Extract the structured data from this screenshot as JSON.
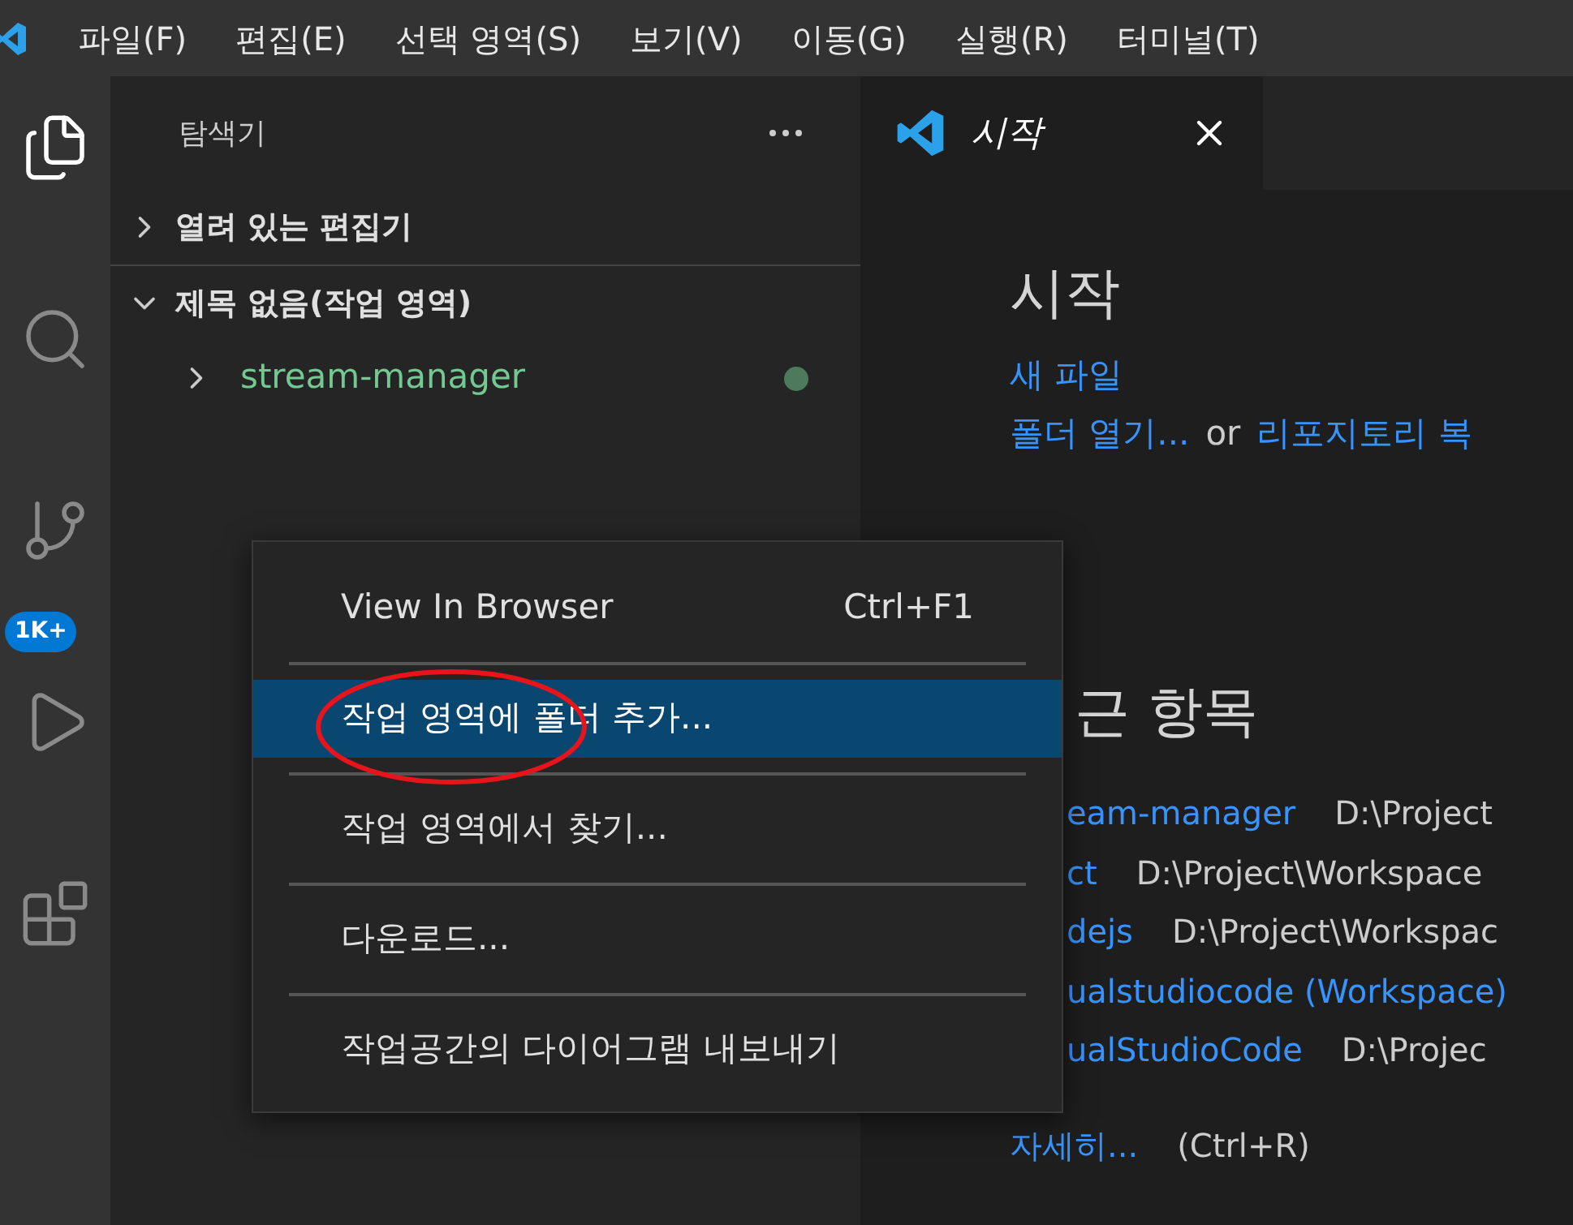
{
  "menu_bar": {
    "items": [
      "파일(F)",
      "편집(E)",
      "선택 영역(S)",
      "보기(V)",
      "이동(G)",
      "실행(R)",
      "터미널(T)"
    ]
  },
  "activity_bar": {
    "items": [
      {
        "kind": "files",
        "selected": true
      },
      {
        "kind": "search",
        "selected": false
      },
      {
        "kind": "source-control",
        "selected": false,
        "badge": "1K+"
      },
      {
        "kind": "run",
        "selected": false
      },
      {
        "kind": "extensions",
        "selected": false
      }
    ]
  },
  "sidebar": {
    "title": "탐색기",
    "sections": [
      {
        "label": "열려 있는 편집기",
        "expanded": false
      },
      {
        "label": "제목 없음(작업 영역)",
        "expanded": true,
        "children": [
          {
            "label": "stream-manager",
            "expanded": false,
            "modified": true
          }
        ]
      }
    ]
  },
  "tabs": [
    {
      "label": "시작",
      "selected": true
    }
  ],
  "editor": {
    "heading": "시작",
    "new_file": "새 파일",
    "open_folder": "폴더 열기...",
    "or": "or",
    "clone": "리포지토리 복",
    "recent_heading": "근 항목",
    "recent": [
      {
        "name": "eam-manager",
        "path": "D:\\Project"
      },
      {
        "name": "ct",
        "path": "D:\\Project\\Workspace"
      },
      {
        "name": "dejs",
        "path": "D:\\Project\\Workspac"
      },
      {
        "name": "ualstudiocode (Workspace)"
      },
      {
        "name": "ualStudioCode",
        "path": "D:\\Projec"
      }
    ],
    "more": "자세히...",
    "more_shortcut": "(Ctrl+R)"
  },
  "context_menu": {
    "groups": [
      [
        {
          "label": "View In Browser",
          "shortcut": "Ctrl+F1",
          "selected": false
        }
      ],
      [
        {
          "label": "작업 영역에 폴더 추가...",
          "selected": true
        }
      ],
      [
        {
          "label": "작업 영역에서 찾기...",
          "selected": false
        }
      ],
      [
        {
          "label": "다운로드...",
          "selected": false
        }
      ],
      [
        {
          "label": "작업공간의 다이어그램 내보내기",
          "selected": false
        }
      ]
    ]
  },
  "annotation": {
    "kind": "ellipse"
  }
}
